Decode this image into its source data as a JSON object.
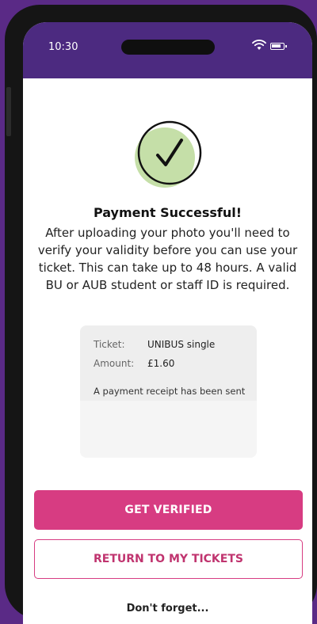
{
  "status_bar": {
    "time": "10:30"
  },
  "success": {
    "title": "Payment Successful!",
    "message": "After uploading your photo you'll need to verify your validity before you can use your ticket. This can take up to 48 hours. A valid BU or AUB student or staff ID is required."
  },
  "receipt_card": {
    "ticket_label": "Ticket:",
    "ticket_value": "UNIBUS single",
    "amount_label": "Amount:",
    "amount_value": "£1.60",
    "receipt_note": "A payment receipt has been sent"
  },
  "actions": {
    "primary_label": "GET VERIFIED",
    "secondary_label": "RETURN TO MY TICKETS"
  },
  "footer": {
    "heading": "Don't forget..."
  },
  "colors": {
    "accent": "#d73c82",
    "header": "#4c2a80",
    "check_fill": "#c5dfa8",
    "page_bg": "#5a2a86"
  },
  "icons": {
    "check": "check-circle-icon",
    "wifi": "wifi-icon",
    "battery": "battery-icon"
  }
}
